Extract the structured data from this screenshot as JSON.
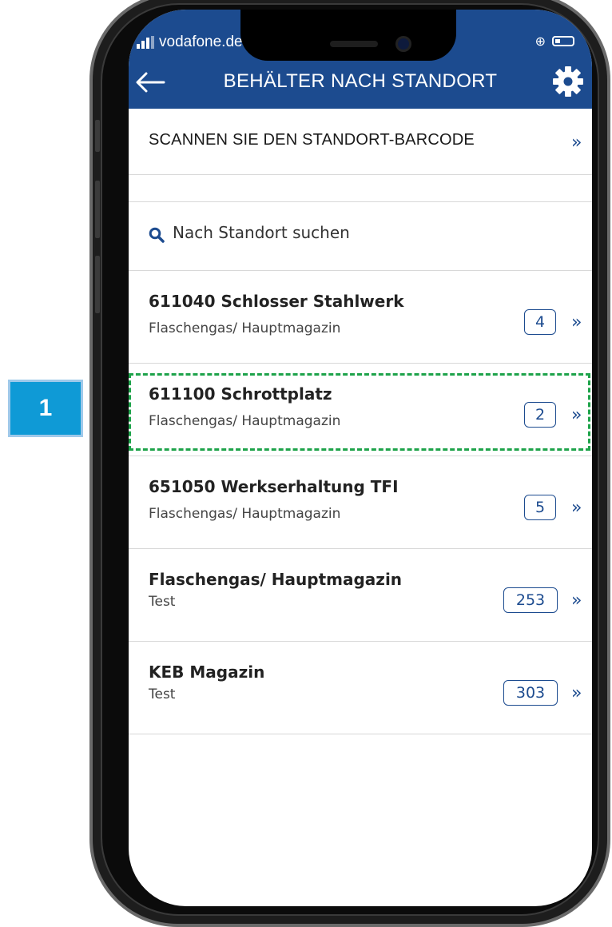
{
  "annotation": {
    "step_number": "1"
  },
  "status_bar": {
    "carrier": "vodafone.de"
  },
  "header": {
    "title": "BEHÄLTER NACH STANDORT",
    "back_icon": "arrow-left-icon",
    "settings_icon": "gear-icon"
  },
  "scan": {
    "label": "SCANNEN SIE DEN STANDORT-BARCODE",
    "chevron": "»"
  },
  "search": {
    "placeholder": "Nach Standort suchen"
  },
  "locations": [
    {
      "name": "611040 Schlosser Stahlwerk",
      "sub": "Flaschengas/ Hauptmagazin",
      "count": "4",
      "chevron": "»"
    },
    {
      "name": "611100 Schrottplatz",
      "sub": "Flaschengas/ Hauptmagazin",
      "count": "2",
      "chevron": "»",
      "highlighted": true
    },
    {
      "name": "651050 Werkserhaltung TFI",
      "sub": "Flaschengas/ Hauptmagazin",
      "count": "5",
      "chevron": "»"
    },
    {
      "name": "Flaschengas/ Hauptmagazin",
      "sub": "Test",
      "count": "253",
      "chevron": "»"
    },
    {
      "name": "KEB Magazin",
      "sub": "Test",
      "count": "303",
      "chevron": "»"
    }
  ],
  "colors": {
    "primary": "#1c4b8f",
    "highlight": "#1ea34a",
    "marker": "#0f9ad6"
  }
}
